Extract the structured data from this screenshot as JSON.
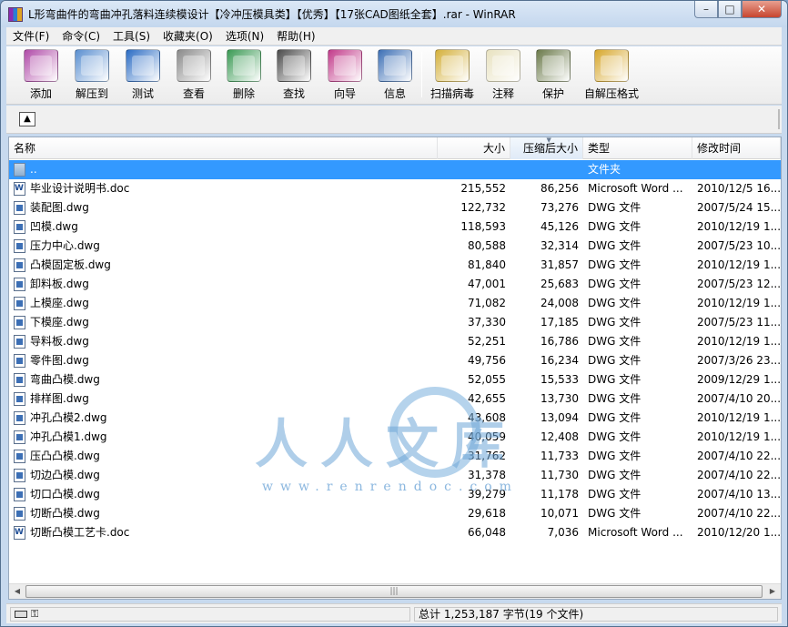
{
  "window": {
    "title": "L形弯曲件的弯曲冲孔落料连续模设计【冷冲压模具类】【优秀】【17张CAD图纸全套】.rar - WinRAR",
    "app_icon": "winrar-icon",
    "buttons": {
      "minimize": "–",
      "maximize": "□",
      "close": "✕"
    }
  },
  "menu": [
    "文件(F)",
    "命令(C)",
    "工具(S)",
    "收藏夹(O)",
    "选项(N)",
    "帮助(H)"
  ],
  "toolbar": [
    {
      "label": "添加",
      "icon": "add-icon",
      "color": "#b04aa8"
    },
    {
      "label": "解压到",
      "icon": "extract-icon",
      "color": "#5a8fd0"
    },
    {
      "label": "测试",
      "icon": "test-icon",
      "color": "#2b6cc4"
    },
    {
      "label": "查看",
      "icon": "view-icon",
      "color": "#8a8a8a"
    },
    {
      "label": "删除",
      "icon": "delete-icon",
      "color": "#3a9a54"
    },
    {
      "label": "查找",
      "icon": "find-icon",
      "color": "#4b4b4b"
    },
    {
      "label": "向导",
      "icon": "wizard-icon",
      "color": "#c23a8a"
    },
    {
      "label": "信息",
      "icon": "info-icon",
      "color": "#3c6fb5"
    },
    {
      "label": "扫描病毒",
      "icon": "scan-virus-icon",
      "color": "#d4b03a"
    },
    {
      "label": "注释",
      "icon": "comment-icon",
      "color": "#e8e2c0"
    },
    {
      "label": "保护",
      "icon": "protect-icon",
      "color": "#6b7a4a"
    },
    {
      "label": "自解压格式",
      "icon": "sfx-icon",
      "color": "#d7a72b"
    }
  ],
  "columns": {
    "name": "名称",
    "size": "大小",
    "packed": "压缩后大小",
    "type": "类型",
    "modified": "修改时间"
  },
  "files": [
    {
      "name": "..",
      "size": "",
      "packed": "",
      "type": "文件夹",
      "modified": "",
      "kind": "folder"
    },
    {
      "name": "毕业设计说明书.doc",
      "size": "215,552",
      "packed": "86,256",
      "type": "Microsoft Word ...",
      "modified": "2010/12/5 16...",
      "kind": "doc"
    },
    {
      "name": "装配图.dwg",
      "size": "122,732",
      "packed": "73,276",
      "type": "DWG 文件",
      "modified": "2007/5/24 15...",
      "kind": "dwg"
    },
    {
      "name": "凹模.dwg",
      "size": "118,593",
      "packed": "45,126",
      "type": "DWG 文件",
      "modified": "2010/12/19 1...",
      "kind": "dwg"
    },
    {
      "name": "压力中心.dwg",
      "size": "80,588",
      "packed": "32,314",
      "type": "DWG 文件",
      "modified": "2007/5/23 10...",
      "kind": "dwg"
    },
    {
      "name": "凸模固定板.dwg",
      "size": "81,840",
      "packed": "31,857",
      "type": "DWG 文件",
      "modified": "2010/12/19 1...",
      "kind": "dwg"
    },
    {
      "name": "卸料板.dwg",
      "size": "47,001",
      "packed": "25,683",
      "type": "DWG 文件",
      "modified": "2007/5/23 12...",
      "kind": "dwg"
    },
    {
      "name": "上模座.dwg",
      "size": "71,082",
      "packed": "24,008",
      "type": "DWG 文件",
      "modified": "2010/12/19 1...",
      "kind": "dwg"
    },
    {
      "name": "下模座.dwg",
      "size": "37,330",
      "packed": "17,185",
      "type": "DWG 文件",
      "modified": "2007/5/23 11...",
      "kind": "dwg"
    },
    {
      "name": "导料板.dwg",
      "size": "52,251",
      "packed": "16,786",
      "type": "DWG 文件",
      "modified": "2010/12/19 1...",
      "kind": "dwg"
    },
    {
      "name": "零件图.dwg",
      "size": "49,756",
      "packed": "16,234",
      "type": "DWG 文件",
      "modified": "2007/3/26 23...",
      "kind": "dwg"
    },
    {
      "name": "弯曲凸模.dwg",
      "size": "52,055",
      "packed": "15,533",
      "type": "DWG 文件",
      "modified": "2009/12/29 1...",
      "kind": "dwg"
    },
    {
      "name": "排样图.dwg",
      "size": "42,655",
      "packed": "13,730",
      "type": "DWG 文件",
      "modified": "2007/4/10 20...",
      "kind": "dwg"
    },
    {
      "name": "冲孔凸模2.dwg",
      "size": "43,608",
      "packed": "13,094",
      "type": "DWG 文件",
      "modified": "2010/12/19 1...",
      "kind": "dwg"
    },
    {
      "name": "冲孔凸模1.dwg",
      "size": "40,059",
      "packed": "12,408",
      "type": "DWG 文件",
      "modified": "2010/12/19 1...",
      "kind": "dwg"
    },
    {
      "name": "压凸凸模.dwg",
      "size": "31,762",
      "packed": "11,733",
      "type": "DWG 文件",
      "modified": "2007/4/10 22...",
      "kind": "dwg"
    },
    {
      "name": "切边凸模.dwg",
      "size": "31,378",
      "packed": "11,730",
      "type": "DWG 文件",
      "modified": "2007/4/10 22...",
      "kind": "dwg"
    },
    {
      "name": "切口凸模.dwg",
      "size": "39,279",
      "packed": "11,178",
      "type": "DWG 文件",
      "modified": "2007/4/10 13...",
      "kind": "dwg"
    },
    {
      "name": "切断凸模.dwg",
      "size": "29,618",
      "packed": "10,071",
      "type": "DWG 文件",
      "modified": "2007/4/10 22...",
      "kind": "dwg"
    },
    {
      "name": "切断凸模工艺卡.doc",
      "size": "66,048",
      "packed": "7,036",
      "type": "Microsoft Word ...",
      "modified": "2010/12/20 1...",
      "kind": "doc"
    }
  ],
  "watermark": {
    "text": "人人文库",
    "url": "www.renrendoc.com"
  },
  "status": {
    "total": "总计 1,253,187 字节(19 个文件)"
  },
  "colors": {
    "selection": "#3399ff",
    "title_bg": "#c7d9ee"
  }
}
